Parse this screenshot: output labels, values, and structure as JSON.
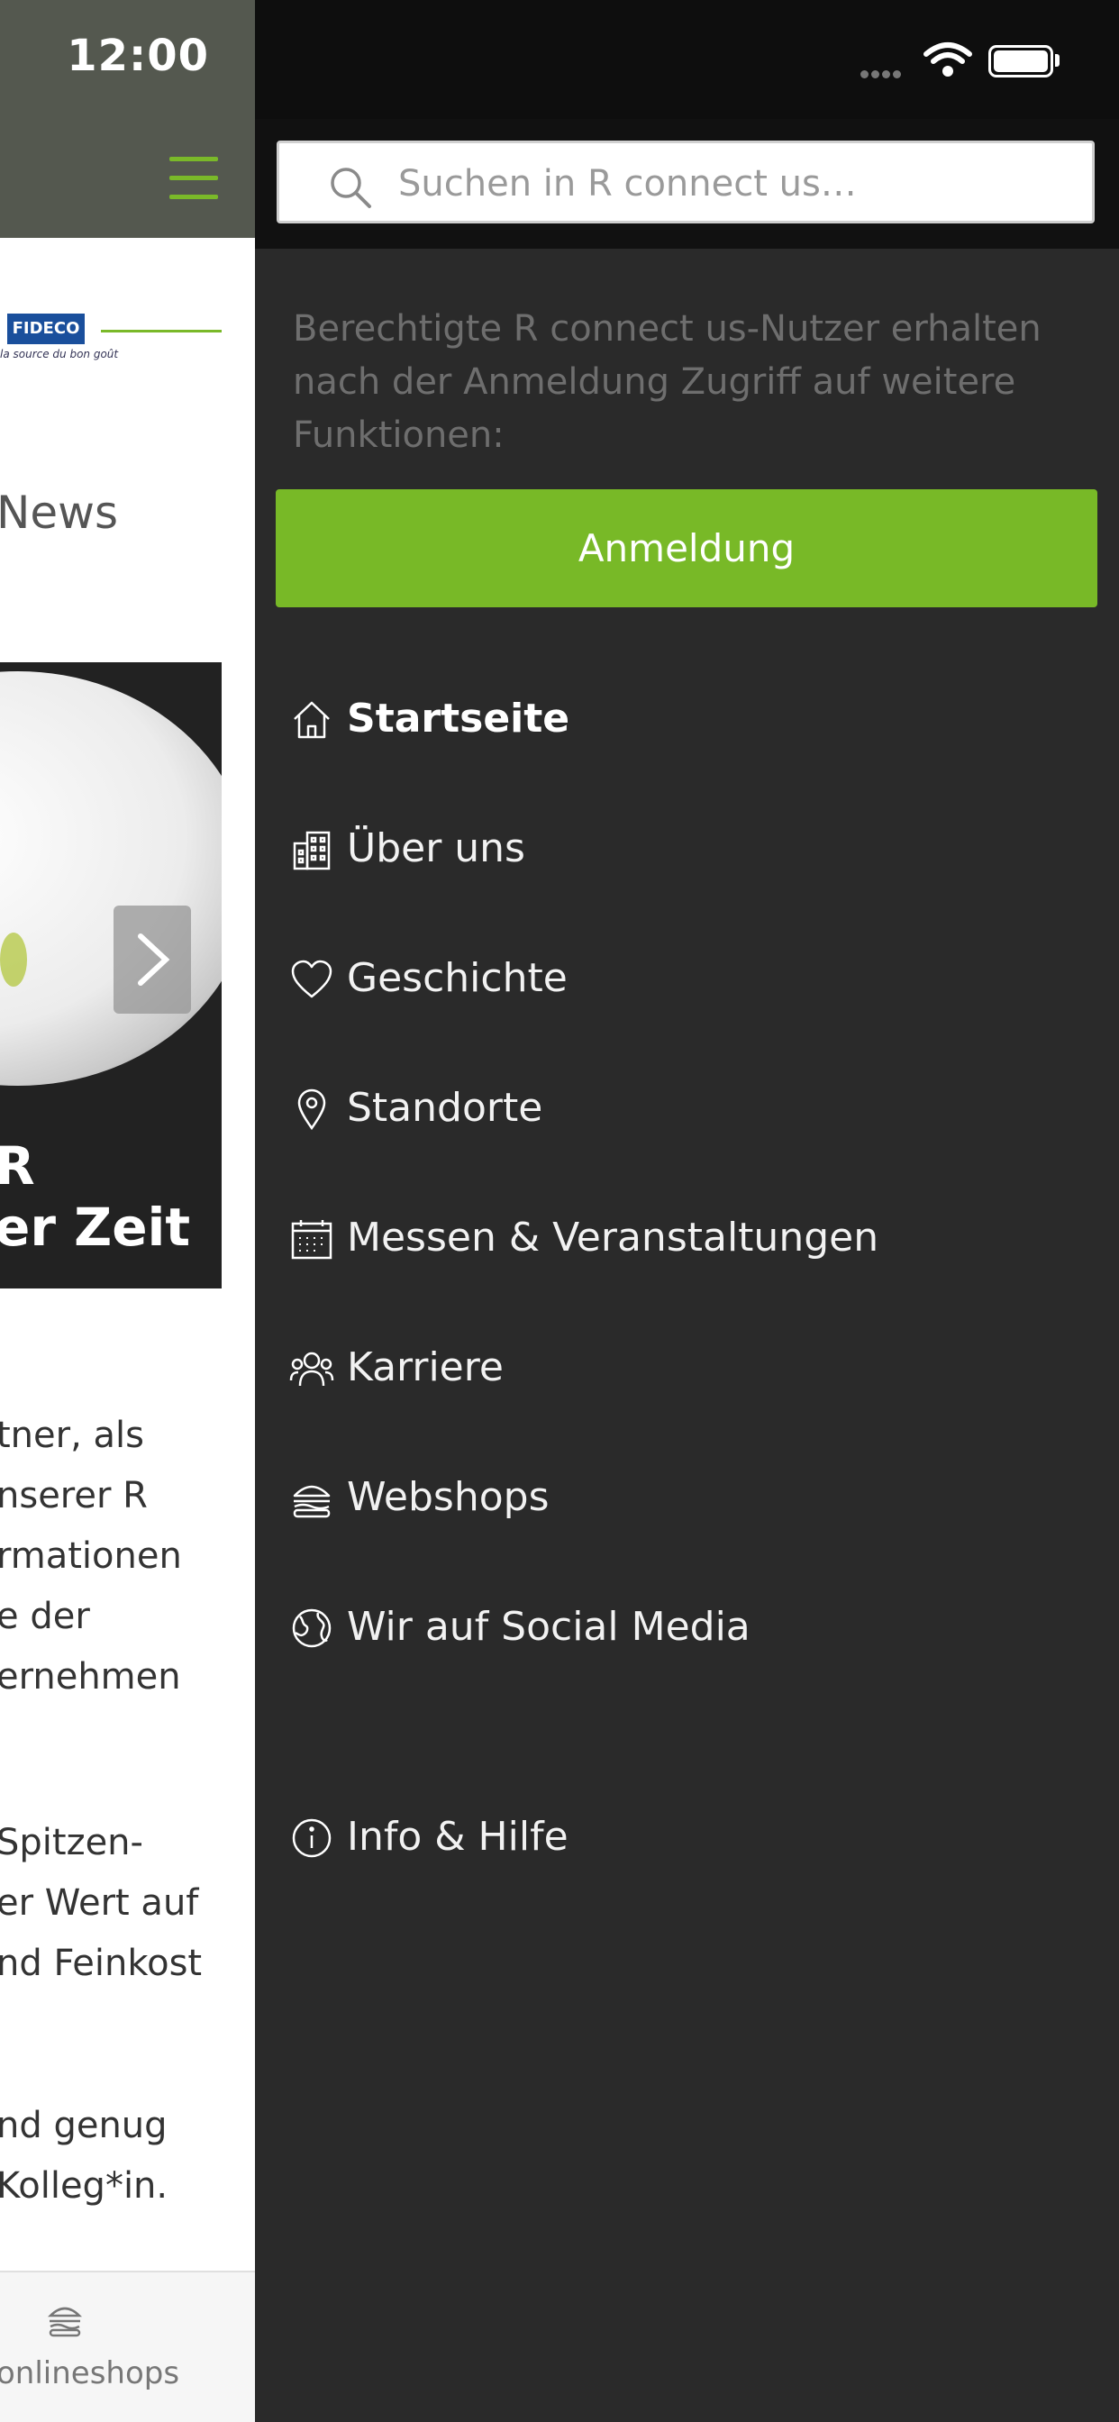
{
  "status_bar": {
    "time": "12:00"
  },
  "background_page": {
    "logo": {
      "brand": "FIDECO",
      "tagline": "la source du bon goût"
    },
    "news_title": "News",
    "slider_caption": [
      "R",
      "er Zeit"
    ],
    "body_paragraphs": [
      [
        "tner, als",
        "nserer R",
        "rmationen",
        "e der",
        "ernehmen"
      ],
      [
        "Spitzen-",
        "er Wert auf",
        "nd Feinkost"
      ],
      [
        "nd genug",
        "Kolleg*in."
      ]
    ],
    "bottom_tab": {
      "label": "onlineshops",
      "icon": "burger-icon"
    }
  },
  "drawer": {
    "search": {
      "placeholder": "Suchen in R connect us…",
      "value": ""
    },
    "info_text": "Berechtigte R connect us-Nutzer erhalten nach der Anmeldung Zugriff auf weitere Funktionen:",
    "login_label": "Anmeldung",
    "accent_color": "#78b927",
    "menu_items": [
      {
        "label": "Startseite",
        "icon": "home-icon",
        "active": true
      },
      {
        "label": "Über uns",
        "icon": "building-icon"
      },
      {
        "label": "Geschichte",
        "icon": "heart-icon"
      },
      {
        "label": "Standorte",
        "icon": "location-pin-icon"
      },
      {
        "label": "Messen & Veranstaltungen",
        "icon": "calendar-icon"
      },
      {
        "label": "Karriere",
        "icon": "people-icon"
      },
      {
        "label": "Webshops",
        "icon": "burger-icon"
      },
      {
        "label": "Wir auf Social Media",
        "icon": "globe-icon"
      },
      {
        "label": "Info & Hilfe",
        "icon": "info-icon"
      }
    ]
  }
}
